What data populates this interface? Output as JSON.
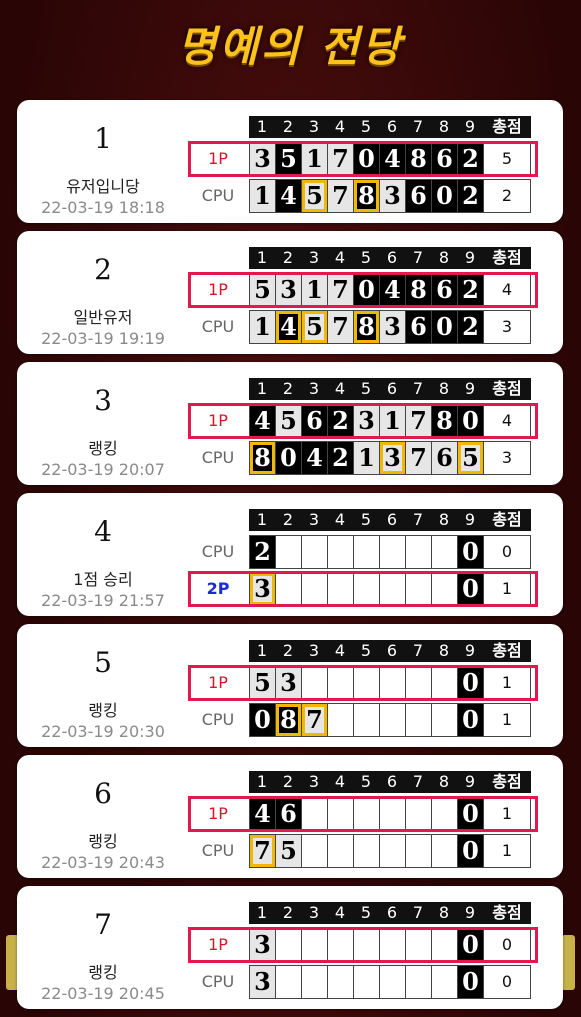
{
  "title": "명예의 전당",
  "columns": [
    "1",
    "2",
    "3",
    "4",
    "5",
    "6",
    "7",
    "8",
    "9",
    "총점"
  ],
  "entries": [
    {
      "rank": "1",
      "name": "유저입니당",
      "date": "22-03-19 18:18",
      "rows": [
        {
          "label": "1P",
          "type": "p1",
          "highlight": true,
          "cells": [
            "3w",
            "5b",
            "1w",
            "7w",
            "0b",
            "4b",
            "8b",
            "6b",
            "2b"
          ],
          "yellow": [
            false,
            false,
            false,
            false,
            false,
            false,
            false,
            false,
            false
          ],
          "total": "5"
        },
        {
          "label": "CPU",
          "type": "cpu",
          "highlight": false,
          "cells": [
            "1w",
            "4b",
            "5w",
            "7w",
            "8b",
            "3w",
            "6b",
            "0b",
            "2b"
          ],
          "yellow": [
            false,
            false,
            true,
            false,
            true,
            false,
            false,
            false,
            false
          ],
          "total": "2"
        }
      ]
    },
    {
      "rank": "2",
      "name": "일반유저",
      "date": "22-03-19 19:19",
      "rows": [
        {
          "label": "1P",
          "type": "p1",
          "highlight": true,
          "cells": [
            "5w",
            "3w",
            "1w",
            "7w",
            "0b",
            "4b",
            "8b",
            "6b",
            "2b"
          ],
          "yellow": [
            false,
            false,
            false,
            false,
            false,
            false,
            false,
            false,
            false
          ],
          "total": "4"
        },
        {
          "label": "CPU",
          "type": "cpu",
          "highlight": false,
          "cells": [
            "1w",
            "4b",
            "5w",
            "7w",
            "8b",
            "3w",
            "6b",
            "0b",
            "2b"
          ],
          "yellow": [
            false,
            true,
            true,
            false,
            true,
            false,
            false,
            false,
            false
          ],
          "total": "3"
        }
      ]
    },
    {
      "rank": "3",
      "name": "랭킹",
      "date": "22-03-19 20:07",
      "rows": [
        {
          "label": "1P",
          "type": "p1",
          "highlight": true,
          "cells": [
            "4b",
            "5w",
            "6b",
            "2b",
            "3w",
            "1w",
            "7w",
            "8b",
            "0b"
          ],
          "yellow": [
            false,
            false,
            false,
            false,
            false,
            false,
            false,
            false,
            false
          ],
          "total": "4"
        },
        {
          "label": "CPU",
          "type": "cpu",
          "highlight": false,
          "cells": [
            "8b",
            "0b",
            "4b",
            "2b",
            "1w",
            "3w",
            "7w",
            "6w",
            "5w"
          ],
          "yellow": [
            true,
            false,
            false,
            false,
            false,
            true,
            false,
            false,
            true
          ],
          "total": "3"
        }
      ]
    },
    {
      "rank": "4",
      "name": "1점 승리",
      "date": "22-03-19 21:57",
      "rows": [
        {
          "label": "CPU",
          "type": "cpu",
          "highlight": false,
          "cells": [
            "2b",
            "",
            "",
            "",
            "",
            "",
            "",
            "",
            "0b"
          ],
          "yellow": [
            false,
            false,
            false,
            false,
            false,
            false,
            false,
            false,
            false
          ],
          "total": "0"
        },
        {
          "label": "2P",
          "type": "p2",
          "highlight": true,
          "cells": [
            "3w",
            "",
            "",
            "",
            "",
            "",
            "",
            "",
            "0b"
          ],
          "yellow": [
            true,
            false,
            false,
            false,
            false,
            false,
            false,
            false,
            false
          ],
          "total": "1"
        }
      ]
    },
    {
      "rank": "5",
      "name": "랭킹",
      "date": "22-03-19 20:30",
      "rows": [
        {
          "label": "1P",
          "type": "p1",
          "highlight": true,
          "cells": [
            "5w",
            "3w",
            "",
            "",
            "",
            "",
            "",
            "",
            "0b"
          ],
          "yellow": [
            false,
            false,
            false,
            false,
            false,
            false,
            false,
            false,
            false
          ],
          "total": "1"
        },
        {
          "label": "CPU",
          "type": "cpu",
          "highlight": false,
          "cells": [
            "0b",
            "8b",
            "7w",
            "",
            "",
            "",
            "",
            "",
            "0b"
          ],
          "yellow": [
            false,
            true,
            true,
            false,
            false,
            false,
            false,
            false,
            false
          ],
          "total": "1"
        }
      ]
    },
    {
      "rank": "6",
      "name": "랭킹",
      "date": "22-03-19 20:43",
      "rows": [
        {
          "label": "1P",
          "type": "p1",
          "highlight": true,
          "cells": [
            "4b",
            "6b",
            "",
            "",
            "",
            "",
            "",
            "",
            "0b"
          ],
          "yellow": [
            false,
            false,
            false,
            false,
            false,
            false,
            false,
            false,
            false
          ],
          "total": "1"
        },
        {
          "label": "CPU",
          "type": "cpu",
          "highlight": false,
          "cells": [
            "7w",
            "5w",
            "",
            "",
            "",
            "",
            "",
            "",
            "0b"
          ],
          "yellow": [
            true,
            false,
            false,
            false,
            false,
            false,
            false,
            false,
            false
          ],
          "total": "1"
        }
      ]
    },
    {
      "rank": "7",
      "name": "랭킹",
      "date": "22-03-19 20:45",
      "rows": [
        {
          "label": "1P",
          "type": "p1",
          "highlight": true,
          "cells": [
            "3w",
            "",
            "",
            "",
            "",
            "",
            "",
            "",
            "0b"
          ],
          "yellow": [
            false,
            false,
            false,
            false,
            false,
            false,
            false,
            false,
            false
          ],
          "total": "0"
        },
        {
          "label": "CPU",
          "type": "cpu",
          "highlight": false,
          "cells": [
            "3w",
            "",
            "",
            "",
            "",
            "",
            "",
            "",
            "0b"
          ],
          "yellow": [
            false,
            false,
            false,
            false,
            false,
            false,
            false,
            false,
            false
          ],
          "total": "0"
        }
      ]
    }
  ]
}
